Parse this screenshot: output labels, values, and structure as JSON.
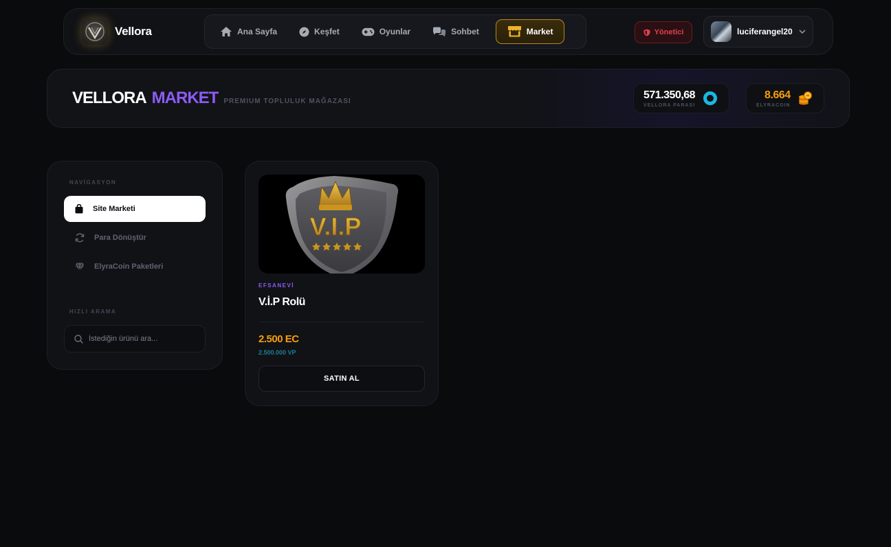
{
  "brand": {
    "name": "Vellora"
  },
  "nav": {
    "items": [
      {
        "label": "Ana Sayfa",
        "icon": "home-icon"
      },
      {
        "label": "Keşfet",
        "icon": "compass-icon"
      },
      {
        "label": "Oyunlar",
        "icon": "gamepad-icon"
      },
      {
        "label": "Sohbet",
        "icon": "chat-icon"
      },
      {
        "label": "Market",
        "icon": "store-icon",
        "active": true
      }
    ]
  },
  "admin_badge": {
    "label": "Yönetici",
    "icon": "shield-icon"
  },
  "user": {
    "name": "luciferangel20",
    "icon": "chevron-down-icon"
  },
  "hero": {
    "title_word1": "VELLORA",
    "title_word2": "MARKET",
    "subtitle": "PREMIUM TOPLULUK MAĞAZASI"
  },
  "wallets": {
    "vp": {
      "amount": "571.350,68",
      "label": "VELLORA PARASI",
      "color": "#19b8e0"
    },
    "ec": {
      "amount": "8.664",
      "label": "ELYRACOIN",
      "color": "#f59e0b"
    }
  },
  "sidebar": {
    "nav_title": "NAVİGASYON",
    "items": [
      {
        "label": "Site Marketi",
        "icon": "shopping-bag-icon",
        "active": true
      },
      {
        "label": "Para Dönüştür",
        "icon": "refresh-icon"
      },
      {
        "label": "ElyraCoin Paketleri",
        "icon": "gem-icon"
      }
    ],
    "search_title": "HIZLI ARAMA",
    "search_placeholder": "İstediğin ürünü ara..."
  },
  "product": {
    "image_text": "V.I.P",
    "rarity": "EFSANEVİ",
    "name": "V.İ.P Rolü",
    "price_ec": "2.500 EC",
    "price_vp": "2.500.000 VP",
    "buy_label": "SATIN AL"
  },
  "colors": {
    "accent_purple": "#8b5cf6",
    "accent_gold": "#f59e0b",
    "accent_cyan": "#19b8e0",
    "danger": "#e0414e"
  }
}
